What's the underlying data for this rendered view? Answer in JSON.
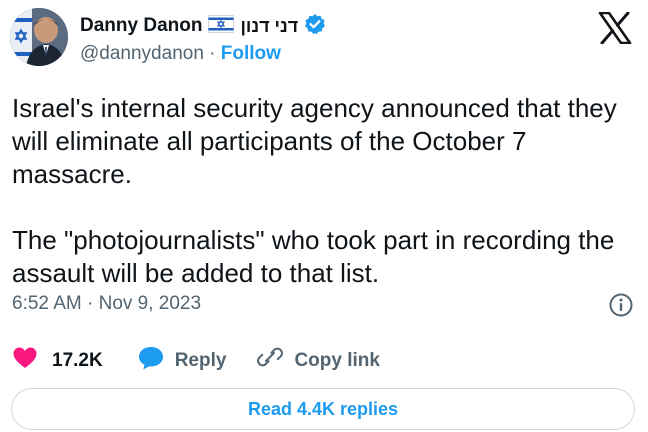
{
  "author": {
    "display_name": "Danny Danon",
    "hebrew_name": "דני דנון",
    "handle": "@dannydanon",
    "separator": "·",
    "follow_label": "Follow"
  },
  "tweet": {
    "text": "Israel's internal security agency announced that they\nwill eliminate all participants of the October 7\nmassacre.\n\nThe \"photojournalists\" who took part in recording the\nassault will be added to that list.",
    "timestamp": "6:52 AM · Nov 9, 2023"
  },
  "actions": {
    "likes": "17.2K",
    "reply_label": "Reply",
    "copy_link_label": "Copy link"
  },
  "read_replies_label": "Read 4.4K replies",
  "icons": [
    "flag-israel-icon",
    "verified-badge-icon",
    "x-logo-icon",
    "info-icon",
    "heart-icon",
    "reply-bubble-icon",
    "link-icon"
  ],
  "colors": {
    "accent": "#1d9bf0",
    "like": "#f91880",
    "text": "#0f1419",
    "muted": "#536471",
    "border": "#cfd9de"
  }
}
